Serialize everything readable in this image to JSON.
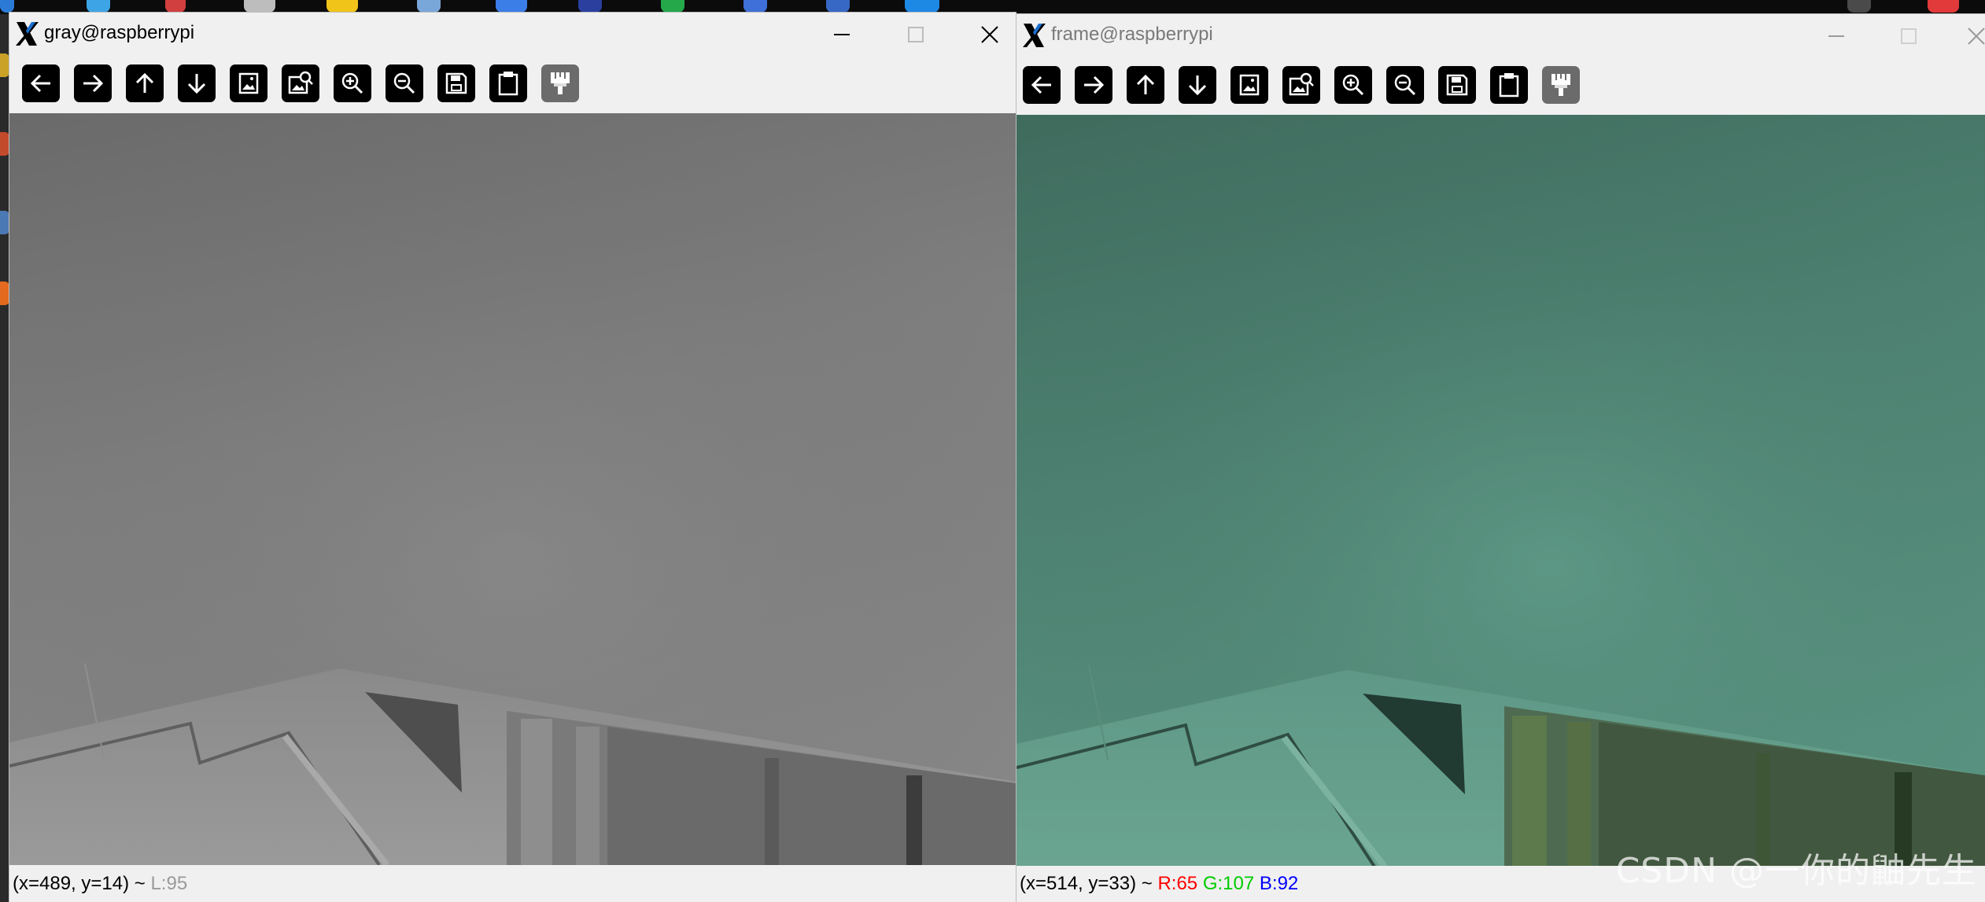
{
  "windows": {
    "gray": {
      "title": "gray@raspberrypi",
      "status_coords": "(x=489, y=14) ~ ",
      "status_level": "L:95"
    },
    "frame": {
      "title": "frame@raspberrypi",
      "status_coords": "(x=514, y=33) ~ ",
      "status_r": "R:65",
      "status_g": "G:107",
      "status_b": "B:92"
    }
  },
  "toolbar_icons": [
    "arrow-left-icon",
    "arrow-right-icon",
    "arrow-up-icon",
    "arrow-down-icon",
    "image-icon",
    "image-zoom-icon",
    "zoom-in-icon",
    "zoom-out-icon",
    "save-icon",
    "clipboard-icon",
    "paint-brush-icon"
  ],
  "watermark": "CSDN @一你的鼬先生",
  "colors": {
    "status_r": "#ff0000",
    "status_g": "#00cc00",
    "status_b": "#0000ff",
    "frame_tint": "#4a7a6b"
  }
}
